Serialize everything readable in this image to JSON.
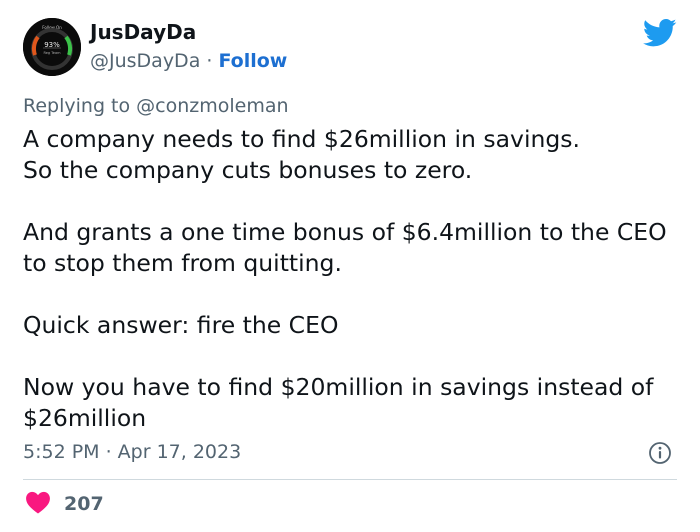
{
  "tweet": {
    "author": {
      "display_name": "JusDayDa",
      "handle": "@JusDayDa",
      "separator": " · ",
      "follow_label": "Follow",
      "avatar_lettering": [
        "Follow On",
        "93%",
        "Reg Team"
      ]
    },
    "reply": {
      "prefix": "Replying to ",
      "mention": "@conzmoleman"
    },
    "text_paragraphs": [
      "A company needs to find $26million in savings.\nSo the company cuts bonuses to zero.",
      "And grants a one time bonus of $6.4million to the CEO to stop them from quitting.",
      "Quick answer: fire the CEO",
      "Now you have to find $20million in savings instead of $26million"
    ],
    "timestamp": "5:52 PM · Apr 17, 2023",
    "likes_count": "207"
  },
  "icons": {
    "brand": "twitter-bird-icon",
    "info": "info-icon",
    "like": "heart-icon"
  },
  "colors": {
    "twitter_blue": "#1d9bf0",
    "follow_blue": "#1d6fd1",
    "like_red": "#f91880",
    "secondary_text": "#536471"
  }
}
